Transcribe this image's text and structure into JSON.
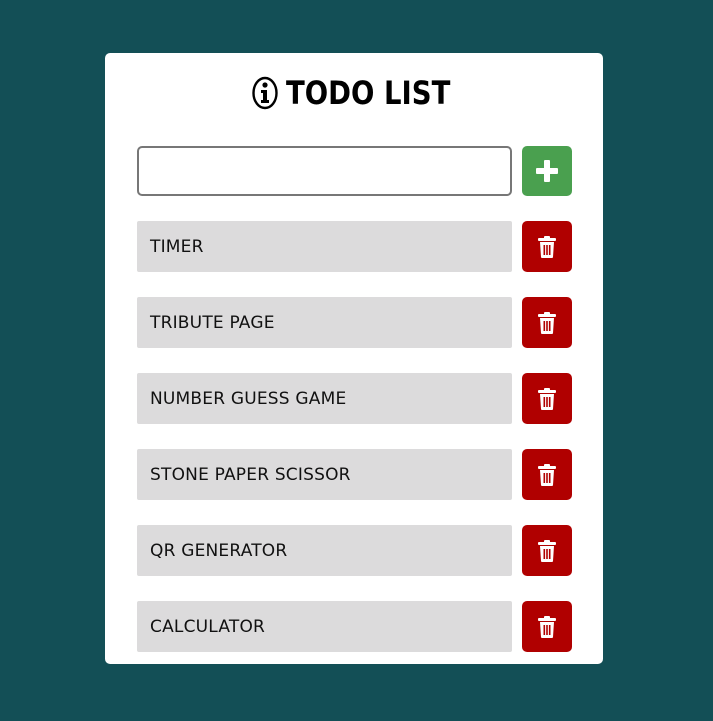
{
  "header": {
    "title": "TODO LIST",
    "icon": "info-icon"
  },
  "input": {
    "value": "",
    "placeholder": ""
  },
  "add_button": {
    "icon": "plus-icon",
    "color": "#4aa04f"
  },
  "delete_button": {
    "icon": "trash-icon",
    "color": "#b00000"
  },
  "todos": [
    {
      "label": "TIMER"
    },
    {
      "label": "TRIBUTE PAGE"
    },
    {
      "label": "NUMBER GUESS GAME"
    },
    {
      "label": "STONE PAPER SCISSOR"
    },
    {
      "label": "QR GENERATOR"
    },
    {
      "label": "CALCULATOR"
    }
  ],
  "colors": {
    "background": "#134f56",
    "card": "#ffffff",
    "item_bg": "#dcdbdc"
  }
}
